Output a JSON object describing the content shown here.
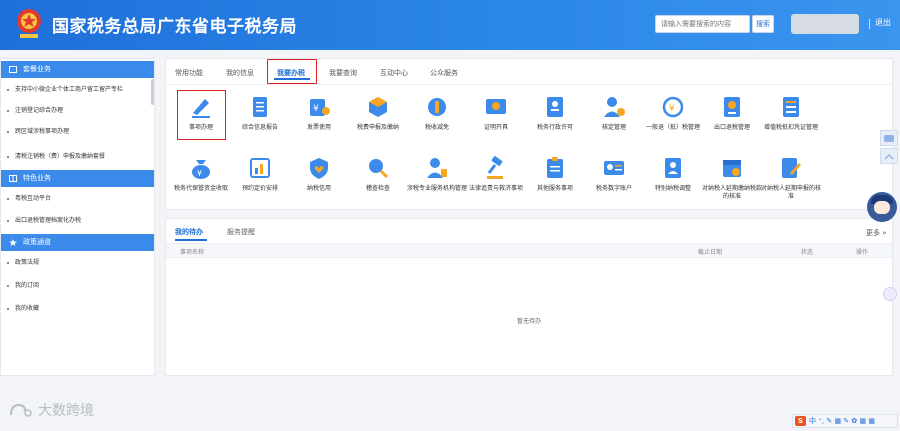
{
  "header": {
    "title": "国家税务总局广东省电子税务局",
    "search_placeholder": "请输入需要搜索的内容",
    "search_button": "搜索",
    "logout": "退出"
  },
  "sidebar": {
    "sections": [
      {
        "title": "套餐业务",
        "items": [
          "支持中小微企业个体工商户留工留产专栏",
          "注销登记综合办理",
          "跨区域涉税事项办理",
          "清税注销税（费）申报及缴纳套餐"
        ]
      },
      {
        "title": "特色业务",
        "items": [
          "粤税互动平台",
          "出口退税管理档案化办税"
        ]
      },
      {
        "title": "政策通道",
        "items": [
          "政策法规",
          "我的订阅",
          "我的收藏"
        ]
      }
    ]
  },
  "main_tabs": [
    "常用功能",
    "我的信息",
    "我要办税",
    "我要查询",
    "互动中心",
    "公众服务"
  ],
  "services": [
    {
      "label": "事项办理",
      "icon": "pen-icon"
    },
    {
      "label": "综合信息报告",
      "icon": "document-icon"
    },
    {
      "label": "发票使用",
      "icon": "invoice-icon"
    },
    {
      "label": "税费申报及缴纳",
      "icon": "box-icon"
    },
    {
      "label": "税收减免",
      "icon": "coins-icon"
    },
    {
      "label": "证明开具",
      "icon": "certificate-icon"
    },
    {
      "label": "税务行政许可",
      "icon": "license-icon"
    },
    {
      "label": "核定管理",
      "icon": "user-gear-icon"
    },
    {
      "label": "一般退（抵）税管理",
      "icon": "refund-icon"
    },
    {
      "label": "出口退税管理",
      "icon": "export-icon"
    },
    {
      "label": "增值税抵扣凭证管理",
      "icon": "ledger-icon"
    },
    {
      "label": "税务代保管资金收取",
      "icon": "moneybag-icon"
    },
    {
      "label": "预约定价安排",
      "icon": "chart-doc-icon"
    },
    {
      "label": "纳税信用",
      "icon": "heart-shield-icon"
    },
    {
      "label": "稽查检查",
      "icon": "inspect-icon"
    },
    {
      "label": "涉税专业服务机构管理",
      "icon": "agent-icon"
    },
    {
      "label": "法律追责与救济事项",
      "icon": "gavel-icon"
    },
    {
      "label": "其他服务事项",
      "icon": "clipboard-icon"
    },
    {
      "label": "税务数字账户",
      "icon": "id-card-icon"
    },
    {
      "label": "特别纳税调整",
      "icon": "user-doc-icon"
    },
    {
      "label": "对纳税人延期缴纳税款的核准",
      "icon": "calendar-icon"
    },
    {
      "label": "对纳税人延期申报的核准",
      "icon": "edit-doc-icon"
    }
  ],
  "tasks": {
    "tabs": [
      "我的待办",
      "服务提醒"
    ],
    "more": "更多 »",
    "columns": [
      "事项名称",
      "截止日期",
      "状态",
      "操作"
    ],
    "empty_text": "暂无待办"
  },
  "watermark": "大数跨境",
  "ime_bar": {
    "badge": "S",
    "text": "中 ⁺, ✎ ▦ ✎ ✿ ▦ ▦"
  },
  "colors": {
    "primary": "#1f6fd8",
    "highlight": "#e02020",
    "sidebar_head": "#3c8ae9"
  }
}
